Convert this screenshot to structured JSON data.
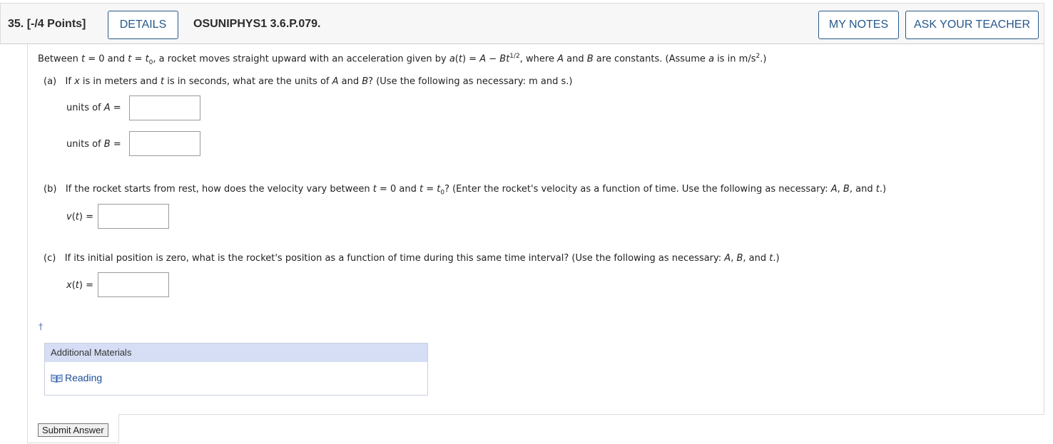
{
  "header": {
    "question_number": "35.",
    "points": "[-/4 Points]",
    "details_label": "DETAILS",
    "code": "OSUNIPHYS1 3.6.P.079.",
    "my_notes_label": "MY NOTES",
    "ask_teacher_label": "ASK YOUR TEACHER"
  },
  "question": {
    "intro": {
      "p1": "Between ",
      "t1": "t",
      "p2": " = 0 and ",
      "t2": "t",
      "p3": " = ",
      "t3": "t",
      "sub0": "0",
      "p4": ", a rocket moves straight upward with an acceleration given by ",
      "a_var": "a",
      "p5": "(",
      "t4": "t",
      "p6": ") = ",
      "A": "A",
      "p7": " − ",
      "B": "Bt",
      "exp": "1/2",
      "p8": ", where ",
      "A2": "A",
      "p9": " and ",
      "B2": "B",
      "p10": " are constants. (Assume ",
      "a2": "a",
      "p11": " is in m/s",
      "exp2": "2",
      "p12": ".)"
    },
    "part_a": {
      "label": "(a)",
      "p1": "If ",
      "x": "x",
      "p2": " is in meters and ",
      "t": "t",
      "p3": " is in seconds, what are the units of ",
      "A": "A",
      "p4": " and ",
      "B": "B",
      "p5": "? (Use the following as necessary: m and s.)",
      "units_a_prefix": "units of ",
      "units_a_var": "A",
      "units_a_suffix": " =",
      "units_b_prefix": "units of ",
      "units_b_var": "B",
      "units_b_suffix": " =",
      "answer_a": "",
      "answer_b": ""
    },
    "part_b": {
      "label": "(b)",
      "p1": "If the rocket starts from rest, how does the velocity vary between ",
      "t1": "t",
      "p2": " = 0 and ",
      "t2": "t",
      "p3": " = ",
      "t3": "t",
      "sub0": "0",
      "p4": "? (Enter the rocket's velocity as a function of time. Use the following as necessary: ",
      "A": "A",
      "p5": ", ",
      "B": "B",
      "p6": ", and ",
      "t4": "t",
      "p7": ".)",
      "v_var": "v",
      "v_t": "t",
      "v_suffix": " =",
      "answer": ""
    },
    "part_c": {
      "label": "(c)",
      "p1": "If its initial position is zero, what is the rocket's position as a function of time during this same time interval? (Use the following as necessary: ",
      "A": "A",
      "p2": ", ",
      "B": "B",
      "p3": ", and ",
      "t": "t",
      "p4": ".)",
      "x_var": "x",
      "x_t": "t",
      "x_suffix": " =",
      "answer": ""
    },
    "dagger": "†"
  },
  "additional_materials": {
    "title": "Additional Materials",
    "reading_label": "Reading",
    "reading_icon": "book-icon"
  },
  "submit_label": "Submit Answer",
  "colors": {
    "accent": "#26598a",
    "header_bg": "#f7f7f7",
    "materials_header_bg": "#d6def5",
    "link": "#1c4f96"
  }
}
